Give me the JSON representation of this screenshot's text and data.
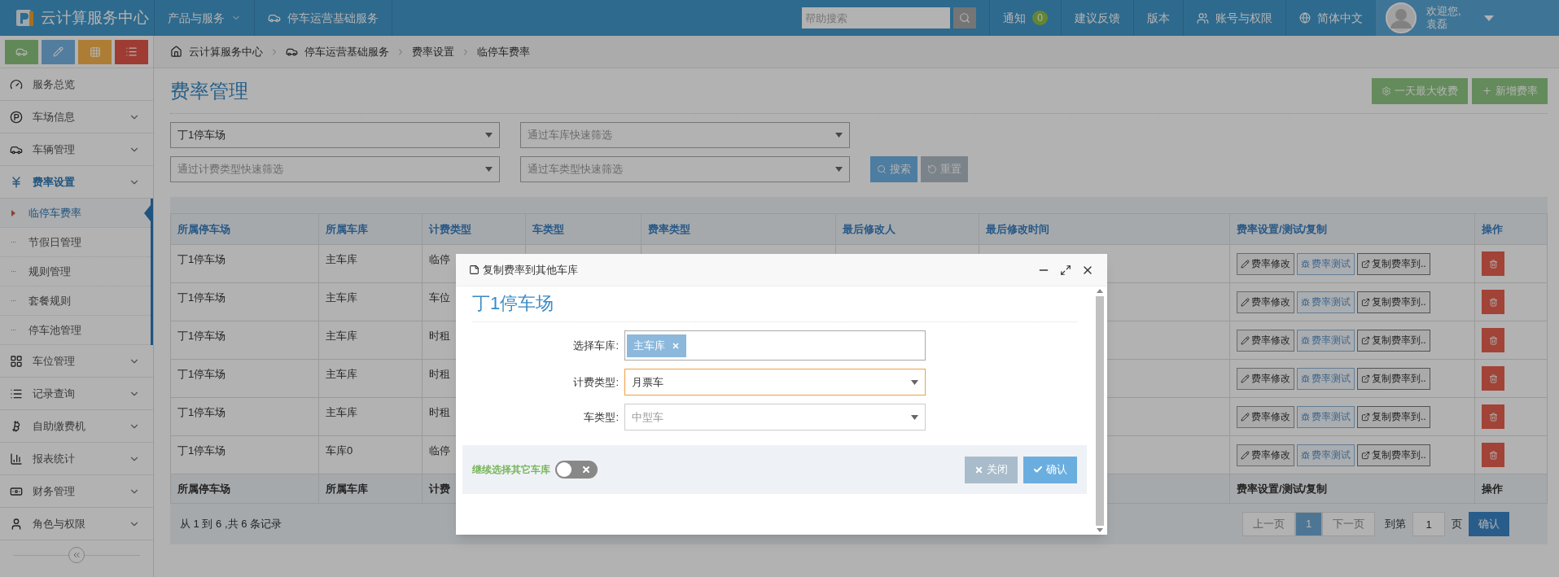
{
  "topbar": {
    "brand": "云计算服务中心",
    "menus": [
      {
        "label": "产品与服务",
        "kind": "dropdown"
      },
      {
        "label": "停车运营基础服务",
        "kind": "car"
      }
    ],
    "search": {
      "placeholder": "帮助搜索"
    },
    "links": [
      {
        "label": "通知",
        "badge": "0"
      },
      {
        "label": "建议反馈"
      },
      {
        "label": "版本"
      },
      {
        "label": "账号与权限"
      },
      {
        "label": "简体中文"
      }
    ],
    "user": {
      "greeting": "欢迎您,",
      "name": "袁磊"
    }
  },
  "sidebar": {
    "items": [
      {
        "label": "服务总览",
        "kind": "link",
        "selected": false
      },
      {
        "label": "车场信息",
        "kind": "group",
        "selected": false
      },
      {
        "label": "车辆管理",
        "kind": "group",
        "selected": false
      },
      {
        "label": "费率设置",
        "kind": "group",
        "selected": true,
        "children": [
          {
            "label": "临停车费率",
            "selected": true
          },
          {
            "label": "节假日管理",
            "selected": false
          },
          {
            "label": "规则管理",
            "selected": false
          },
          {
            "label": "套餐规则",
            "selected": false
          },
          {
            "label": "停车池管理",
            "selected": false
          }
        ]
      },
      {
        "label": "车位管理",
        "kind": "group",
        "selected": false
      },
      {
        "label": "记录查询",
        "kind": "group",
        "selected": false
      },
      {
        "label": "自助缴费机",
        "kind": "group",
        "selected": false
      },
      {
        "label": "报表统计",
        "kind": "group",
        "selected": false
      },
      {
        "label": "财务管理",
        "kind": "group",
        "selected": false
      },
      {
        "label": "角色与权限",
        "kind": "group",
        "selected": false
      }
    ]
  },
  "breadcrumb": [
    "云计算服务中心",
    "停车运营基础服务",
    "费率设置",
    "临停车费率"
  ],
  "page": {
    "title": "费率管理",
    "buttons": [
      "一天最大收费",
      "新增费率"
    ]
  },
  "filters": [
    {
      "value": "丁1停车场"
    },
    {
      "placeholder": "通过车库快速筛选"
    },
    {
      "placeholder": "通过计费类型快速筛选"
    },
    {
      "placeholder": "通过车类型快速筛选"
    }
  ],
  "filter_buttons": {
    "search": "搜索",
    "reset": "重置"
  },
  "table": {
    "columns": [
      "所属停车场",
      "所属车库",
      "计费类型",
      "车类型",
      "费率类型",
      "最后修改人",
      "最后修改时间",
      "费率设置/测试/复制",
      "操作"
    ],
    "rows": [
      {
        "parking_lot": "丁1停车场",
        "garage": "主车库",
        "billing_type": "临停",
        "actions": [
          "费率修改",
          "费率测试",
          "复制费率到.."
        ]
      },
      {
        "parking_lot": "丁1停车场",
        "garage": "主车库",
        "billing_type": "车位",
        "actions": [
          "费率修改",
          "费率测试",
          "复制费率到.."
        ]
      },
      {
        "parking_lot": "丁1停车场",
        "garage": "主车库",
        "billing_type": "时租",
        "actions": [
          "费率修改",
          "费率测试",
          "复制费率到.."
        ]
      },
      {
        "parking_lot": "丁1停车场",
        "garage": "主车库",
        "billing_type": "时租",
        "actions": [
          "费率修改",
          "费率测试",
          "复制费率到.."
        ]
      },
      {
        "parking_lot": "丁1停车场",
        "garage": "主车库",
        "billing_type": "时租",
        "actions": [
          "费率修改",
          "费率测试",
          "复制费率到.."
        ]
      },
      {
        "parking_lot": "丁1停车场",
        "garage": "车库0",
        "billing_type": "临停",
        "actions": [
          "费率修改",
          "费率测试",
          "复制费率到.."
        ]
      }
    ],
    "footer_left": [
      "所属停车场",
      "所属车库",
      "计费"
    ],
    "footer_right": [
      "费率设置/测试/复制",
      "操作"
    ]
  },
  "pagination": {
    "summary": "从 1 到 6 ,共 6 条记录",
    "prev": "上一页",
    "pages": [
      {
        "label": "1",
        "selected": true
      }
    ],
    "next": "下一页",
    "goto_label": "到第",
    "goto_value": "1",
    "page_unit": "页",
    "confirm": "确认"
  },
  "modal": {
    "title": "复制费率到其他车库",
    "heading": "丁1停车场",
    "fields": [
      {
        "kind": "tags",
        "label": "选择车库:",
        "tags": [
          "主车库"
        ]
      },
      {
        "kind": "select",
        "label": "计费类型:",
        "value": "月票车",
        "focused": true
      },
      {
        "kind": "select",
        "label": "车类型:",
        "placeholder": "中型车",
        "focused": false
      }
    ],
    "toggle": {
      "label": "继续选择其它车库",
      "on": false
    },
    "close": "关闭",
    "confirm": "确认"
  }
}
